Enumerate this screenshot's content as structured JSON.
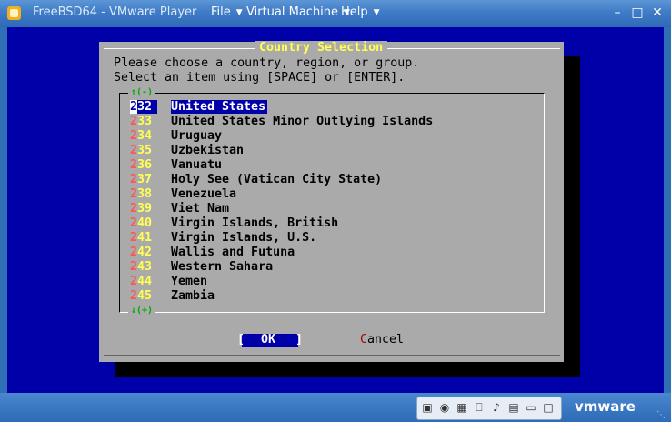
{
  "window": {
    "title": "FreeBSD64 - VMware Player"
  },
  "menus": [
    {
      "label": "File"
    },
    {
      "label": "Virtual Machine"
    },
    {
      "label": "Help"
    }
  ],
  "dialog": {
    "title": "Country Selection",
    "prompt_line1": "Please choose a country, region, or group.",
    "prompt_line2": "Select an item using [SPACE] or [ENTER].",
    "scroll_up": "↑(-)",
    "scroll_down": "↓(+)",
    "items": [
      {
        "hot": "2",
        "rest": "32",
        "label": "United States",
        "selected": true
      },
      {
        "hot": "2",
        "rest": "33",
        "label": "United States Minor Outlying Islands"
      },
      {
        "hot": "2",
        "rest": "34",
        "label": "Uruguay"
      },
      {
        "hot": "2",
        "rest": "35",
        "label": "Uzbekistan"
      },
      {
        "hot": "2",
        "rest": "36",
        "label": "Vanuatu"
      },
      {
        "hot": "2",
        "rest": "37",
        "label": "Holy See (Vatican City State)"
      },
      {
        "hot": "2",
        "rest": "38",
        "label": "Venezuela"
      },
      {
        "hot": "2",
        "rest": "39",
        "label": "Viet Nam"
      },
      {
        "hot": "2",
        "rest": "40",
        "label": "Virgin Islands, British"
      },
      {
        "hot": "2",
        "rest": "41",
        "label": "Virgin Islands, U.S."
      },
      {
        "hot": "2",
        "rest": "42",
        "label": "Wallis and Futuna"
      },
      {
        "hot": "2",
        "rest": "43",
        "label": "Western Sahara"
      },
      {
        "hot": "2",
        "rest": "44",
        "label": "Yemen"
      },
      {
        "hot": "2",
        "rest": "45",
        "label": "Zambia"
      }
    ],
    "ok_open": "[",
    "ok_hot": "O",
    "ok_rest": "K",
    "ok_close": "]",
    "cancel_hot": "C",
    "cancel_rest": "ancel"
  },
  "statusbar": {
    "brand": "vmware"
  },
  "colors": {
    "guest_bg": "#0000a8",
    "dialog_bg": "#aaaaaa",
    "title_fg": "#ffff55",
    "highlight": "#0000aa"
  }
}
